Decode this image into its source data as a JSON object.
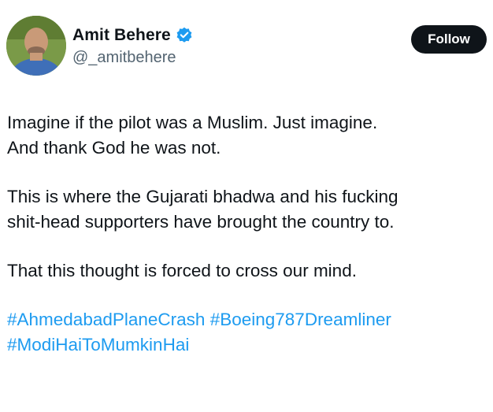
{
  "author": {
    "display_name": "Amit Behere",
    "handle": "@_amitbehere",
    "verified": true,
    "avatar_icon": "user-avatar-photo",
    "verified_icon": "verified-badge-icon"
  },
  "follow_button": {
    "label": "Follow"
  },
  "tweet": {
    "line_1": "Imagine if the pilot was a Muslim. Just imagine.",
    "line_2": "And thank God he was not.",
    "line_3": "This is where the Gujarati bhadwa and his fucking",
    "line_4": "shit-head supporters have brought the country to.",
    "line_5": "That this thought is forced to cross our mind.",
    "hashtags": [
      "#AhmedabadPlaneCrash",
      "#Boeing787Dreamliner",
      "#ModiHaiToMumkinHai"
    ]
  },
  "colors": {
    "text": "#0f1419",
    "secondary": "#536471",
    "link": "#1d9bf0",
    "button_bg": "#0f1419",
    "button_text": "#ffffff"
  }
}
